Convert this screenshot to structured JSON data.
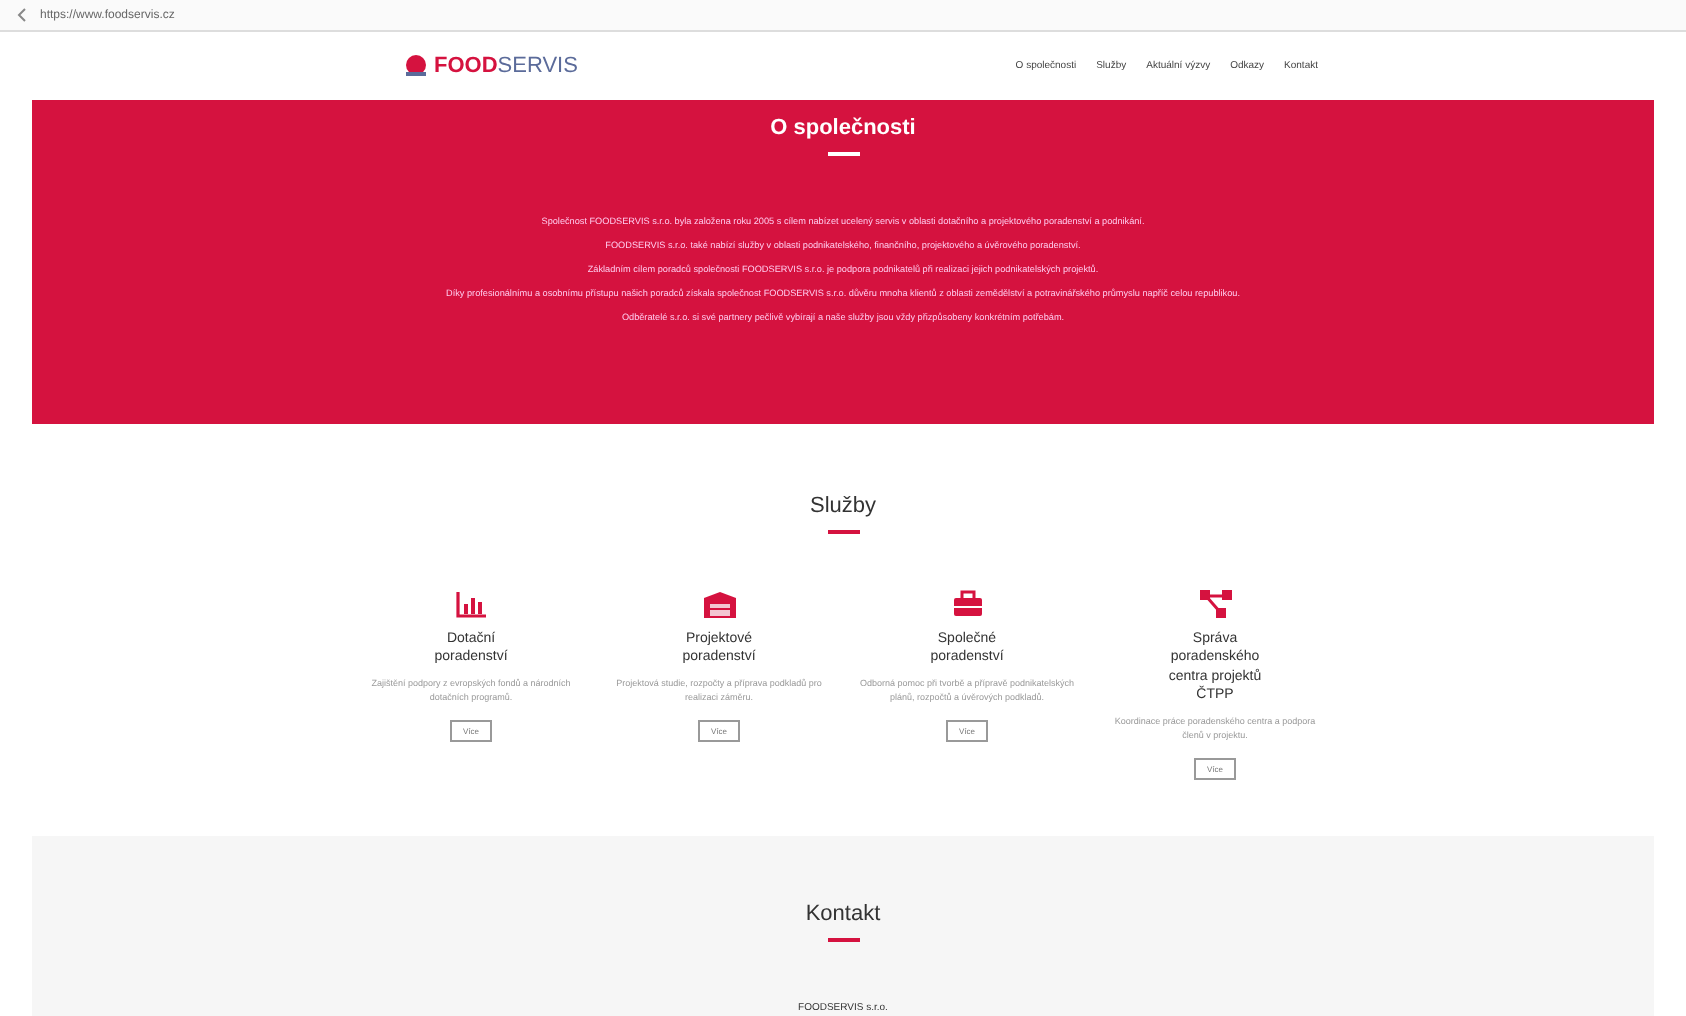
{
  "browser": {
    "url": "https://www.foodservis.cz"
  },
  "header": {
    "logo": {
      "bold": "FOOD",
      "light": "SERVIS"
    },
    "nav": [
      {
        "label": "O společnosti",
        "selected": false
      },
      {
        "label": "Služby",
        "selected": false
      },
      {
        "label": "Aktuální výzvy",
        "selected": false
      },
      {
        "label": "Odkazy",
        "selected": false
      },
      {
        "label": "Kontakt",
        "selected": false
      }
    ]
  },
  "about": {
    "title": "O společnosti",
    "paragraphs": [
      "Společnost FOODSERVIS s.r.o. byla založena roku 2005 s cílem nabízet ucelený servis v oblasti dotačního a projektového poradenství a podnikání.",
      "FOODSERVIS s.r.o. také nabízí služby v oblasti podnikatelského, finančního, projektového a úvěrového poradenství.",
      "Základním cílem poradců společnosti FOODSERVIS s.r.o. je podpora podnikatelů při realizaci jejich podnikatelských projektů.",
      "Díky profesionálnímu a osobnímu přístupu našich poradců získala společnost FOODSERVIS s.r.o. důvěru mnoha klientů z oblasti zemědělství a potravinářského průmyslu napříč celou republikou.",
      "Odběratelé s.r.o. si své partnery pečlivě vybírají a naše služby jsou vždy přizpůsobeny konkrétním potřebám."
    ]
  },
  "services": {
    "title": "Služby",
    "items": [
      {
        "kind": "chart",
        "title": "Dotační poradenství",
        "text": "Zajištění podpory z evropských fondů a národních dotačních programů.",
        "button": "Více"
      },
      {
        "kind": "warehouse",
        "title": "Projektové poradenství",
        "text": "Projektová studie, rozpočty a příprava podkladů pro realizaci záměru.",
        "button": "Více"
      },
      {
        "kind": "toolbox",
        "title": "Společné poradenství",
        "text": "Odborná pomoc při tvorbě a přípravě podnikatelských plánů, rozpočtů a úvěrových podkladů.",
        "button": "Více"
      },
      {
        "kind": "network",
        "title": "Správa poradenského centra projektů ČTPP",
        "text": "Koordinace práce poradenského centra a podpora členů v projektu.",
        "button": "Více"
      }
    ]
  },
  "contact": {
    "title": "Kontakt",
    "company": "FOODSERVIS s.r.o."
  }
}
